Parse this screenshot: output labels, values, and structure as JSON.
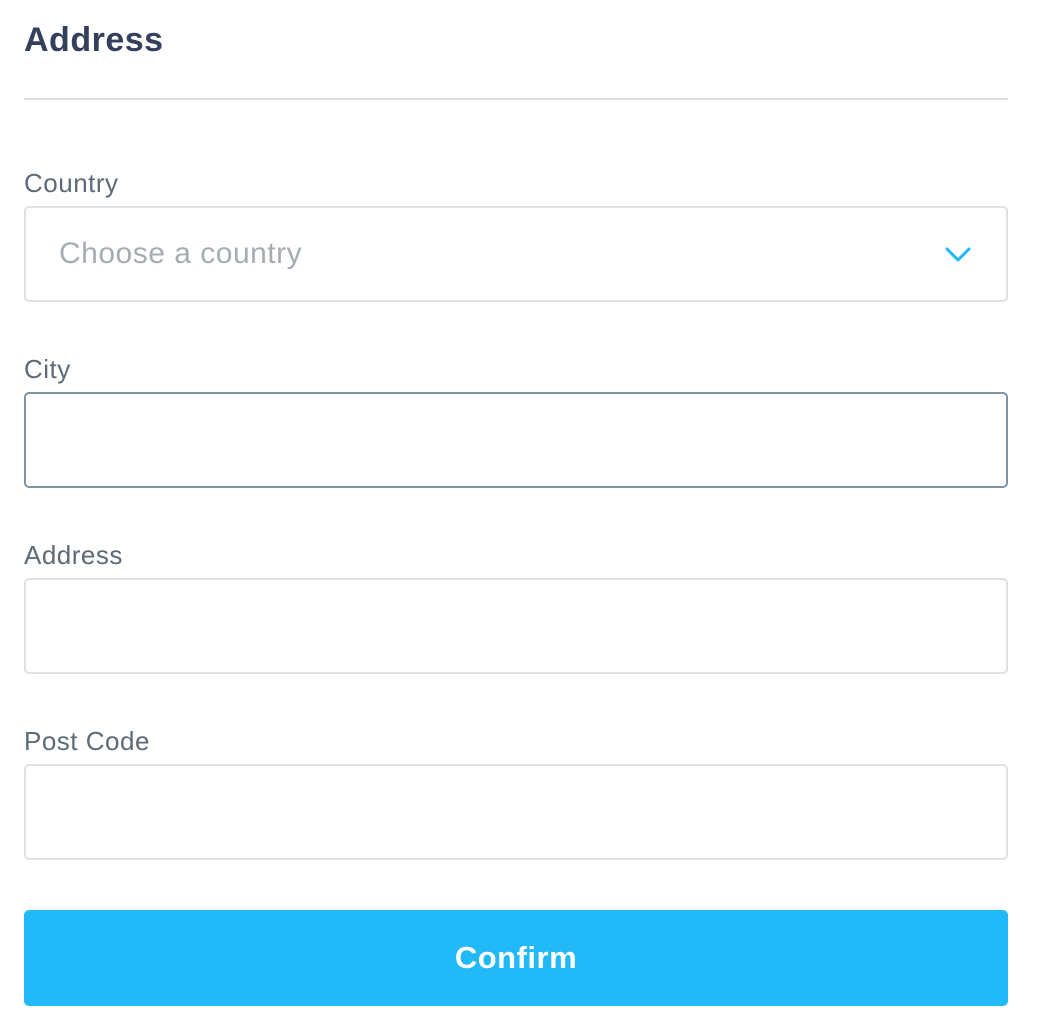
{
  "form": {
    "title": "Address",
    "country": {
      "label": "Country",
      "placeholder": "Choose a country",
      "icon": "chevron-down-icon"
    },
    "city": {
      "label": "City",
      "value": ""
    },
    "address": {
      "label": "Address",
      "value": ""
    },
    "post_code": {
      "label": "Post Code",
      "value": ""
    },
    "confirm_label": "Confirm"
  },
  "colors": {
    "accent": "#22b9f8",
    "title": "#34405c",
    "label": "#5d6b78",
    "placeholder": "#a7acb2",
    "border": "#dde0e4",
    "border_focused": "#8093a3"
  }
}
